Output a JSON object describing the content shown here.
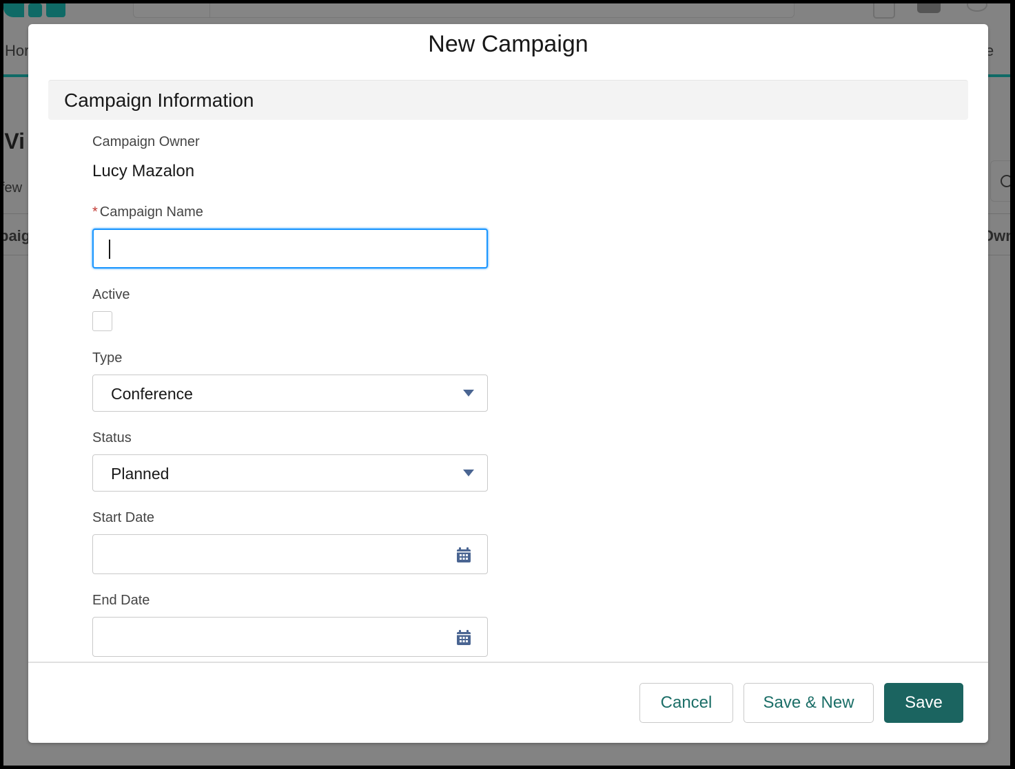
{
  "background": {
    "nav_partial_left": "Hor",
    "nav_partial_right": "e",
    "title_partial": "r Vi",
    "subtitle_partial": "few",
    "column_partial_left": "paig",
    "column_partial_right": "Own"
  },
  "modal": {
    "title": "New Campaign",
    "section_title": "Campaign Information",
    "fields": {
      "owner": {
        "label": "Campaign Owner",
        "value": "Lucy Mazalon"
      },
      "name": {
        "label": "Campaign Name",
        "required_marker": "*",
        "value": "",
        "placeholder": ""
      },
      "active": {
        "label": "Active",
        "checked": false
      },
      "type": {
        "label": "Type",
        "value": "Conference"
      },
      "status": {
        "label": "Status",
        "value": "Planned"
      },
      "start_date": {
        "label": "Start Date",
        "value": "",
        "icon": "calendar-icon"
      },
      "end_date": {
        "label": "End Date",
        "value": "",
        "icon": "calendar-icon"
      }
    },
    "buttons": {
      "cancel": "Cancel",
      "save_new": "Save & New",
      "save": "Save"
    }
  },
  "colors": {
    "brand": "#1b6460",
    "focus_ring": "#1b96ff",
    "required": "#c23934",
    "icon": "#4a6592"
  }
}
